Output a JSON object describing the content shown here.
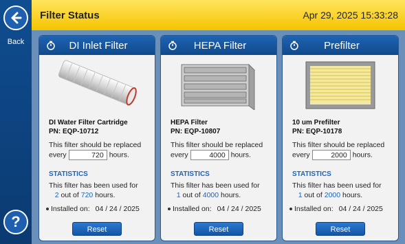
{
  "nav": {
    "back_label": "Back"
  },
  "header": {
    "title": "Filter Status",
    "datetime": "Apr 29, 2025 15:33:28"
  },
  "cards": [
    {
      "title": "DI Inlet Filter",
      "name": "DI Water Filter Cartridge",
      "pn": "PN: EQP-10712",
      "replace_pre": "This filter should be replaced every",
      "replace_hours": "720",
      "replace_post": "hours.",
      "stats_head": "STATISTICS",
      "stats_pre": "This filter has been used for",
      "used": "2",
      "out_of": "out of",
      "total": "720",
      "hours": "hours.",
      "installed_label": "Installed on:",
      "installed_date": "04 / 24 / 2025",
      "reset": "Reset"
    },
    {
      "title": "HEPA Filter",
      "name": "HEPA Filter",
      "pn": "PN: EQP-10807",
      "replace_pre": "This filter should be replaced every",
      "replace_hours": "4000",
      "replace_post": "hours.",
      "stats_head": "STATISTICS",
      "stats_pre": "This filter has been used for",
      "used": "1",
      "out_of": "out of",
      "total": "4000",
      "hours": "hours.",
      "installed_label": "Installed on:",
      "installed_date": "04 / 24 / 2025",
      "reset": "Reset"
    },
    {
      "title": "Prefilter",
      "name": "10 um Prefilter",
      "pn": "PN: EQP-10178",
      "replace_pre": "This filter should be replaced every",
      "replace_hours": "2000",
      "replace_post": "hours.",
      "stats_head": "STATISTICS",
      "stats_pre": "This filter has been used for",
      "used": "1",
      "out_of": "out of",
      "total": "2000",
      "hours": "hours.",
      "installed_label": "Installed on:",
      "installed_date": "04 / 24 / 2025",
      "reset": "Reset"
    }
  ],
  "help": {
    "label": "?"
  }
}
